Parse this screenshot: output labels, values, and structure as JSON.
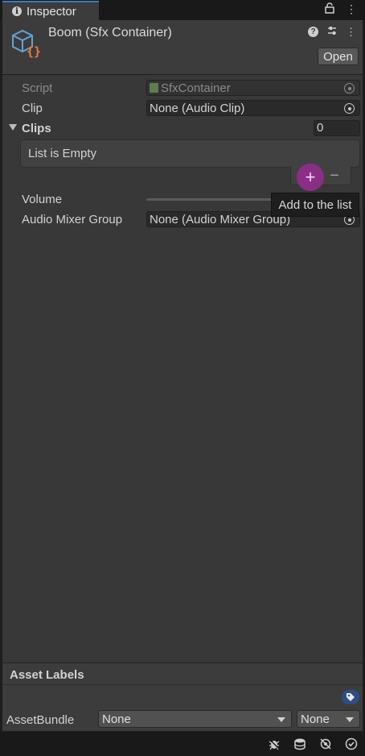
{
  "tab": {
    "title": "Inspector",
    "icon": "info-icon"
  },
  "tab_tools": {
    "lock": "lock-icon",
    "menu": "⋮"
  },
  "header": {
    "title": "Boom (Sfx Container)",
    "open_label": "Open",
    "icons": [
      "help-icon",
      "preset-icon",
      "more-icon"
    ]
  },
  "fields": {
    "script": {
      "label": "Script",
      "value": "SfxContainer"
    },
    "clip": {
      "label": "Clip",
      "value": "None (Audio Clip)"
    },
    "clips": {
      "label": "Clips",
      "count": "0",
      "empty_text": "List is Empty"
    },
    "volume": {
      "label": "Volume"
    },
    "mixer": {
      "label": "Audio Mixer Group",
      "value": "None (Audio Mixer Group)"
    }
  },
  "list_controls": {
    "add": "+",
    "remove": "−"
  },
  "tooltip": "Add to the list",
  "asset_labels": {
    "title": "Asset Labels",
    "assetbundle_label": "AssetBundle",
    "bundle_value": "None",
    "variant_value": "None"
  },
  "colors": {
    "accent_tab": "#3a79bb",
    "add_button": "#8b2f86",
    "tag_button": "#2c4e85"
  }
}
